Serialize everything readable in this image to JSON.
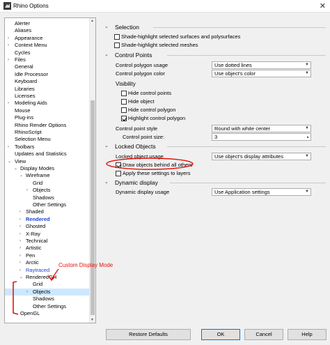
{
  "window": {
    "title": "Rhino Options",
    "close_glyph": "✕"
  },
  "tree": {
    "items": [
      {
        "label": "Alerter",
        "level": 0,
        "arrow": ""
      },
      {
        "label": "Aliases",
        "level": 0,
        "arrow": ""
      },
      {
        "label": "Appearance",
        "level": 0,
        "arrow": "›"
      },
      {
        "label": "Context Menu",
        "level": 0,
        "arrow": "›"
      },
      {
        "label": "Cycles",
        "level": 0,
        "arrow": ""
      },
      {
        "label": "Files",
        "level": 0,
        "arrow": "›"
      },
      {
        "label": "General",
        "level": 0,
        "arrow": ""
      },
      {
        "label": "Idle Processor",
        "level": 0,
        "arrow": ""
      },
      {
        "label": "Keyboard",
        "level": 0,
        "arrow": ""
      },
      {
        "label": "Libraries",
        "level": 0,
        "arrow": ""
      },
      {
        "label": "Licenses",
        "level": 0,
        "arrow": ""
      },
      {
        "label": "Modeling Aids",
        "level": 0,
        "arrow": "›"
      },
      {
        "label": "Mouse",
        "level": 0,
        "arrow": ""
      },
      {
        "label": "Plug-ins",
        "level": 0,
        "arrow": ""
      },
      {
        "label": "Rhino Render Options",
        "level": 0,
        "arrow": ""
      },
      {
        "label": "RhinoScript",
        "level": 0,
        "arrow": ""
      },
      {
        "label": "Selection Menu",
        "level": 0,
        "arrow": ""
      },
      {
        "label": "Toolbars",
        "level": 0,
        "arrow": "›"
      },
      {
        "label": "Updates and Statistics",
        "level": 0,
        "arrow": ""
      },
      {
        "label": "View",
        "level": 0,
        "arrow": "⌄"
      },
      {
        "label": "Display Modes",
        "level": 1,
        "arrow": "⌄"
      },
      {
        "label": "Wireframe",
        "level": 2,
        "arrow": "⌄"
      },
      {
        "label": "Grid",
        "level": 3,
        "arrow": ""
      },
      {
        "label": "Objects",
        "level": 3,
        "arrow": "›"
      },
      {
        "label": "Shadows",
        "level": 3,
        "arrow": ""
      },
      {
        "label": "Other Settings",
        "level": 3,
        "arrow": ""
      },
      {
        "label": "Shaded",
        "level": 2,
        "arrow": "›"
      },
      {
        "label": "Rendered",
        "level": 2,
        "arrow": "›",
        "style": "bold-blue"
      },
      {
        "label": "Ghosted",
        "level": 2,
        "arrow": "›"
      },
      {
        "label": "X-Ray",
        "level": 2,
        "arrow": "›"
      },
      {
        "label": "Technical",
        "level": 2,
        "arrow": "›"
      },
      {
        "label": "Artistic",
        "level": 2,
        "arrow": "›"
      },
      {
        "label": "Pen",
        "level": 2,
        "arrow": "›"
      },
      {
        "label": "Arctic",
        "level": 2,
        "arrow": "›"
      },
      {
        "label": "Raytraced",
        "level": 2,
        "arrow": "›",
        "style": "blue"
      },
      {
        "label": "RenderedGH",
        "level": 2,
        "arrow": "⌄"
      },
      {
        "label": "Grid",
        "level": 3,
        "arrow": ""
      },
      {
        "label": "Objects",
        "level": 3,
        "arrow": "›",
        "selected": true
      },
      {
        "label": "Shadows",
        "level": 3,
        "arrow": ""
      },
      {
        "label": "Other Settings",
        "level": 3,
        "arrow": ""
      },
      {
        "label": "OpenGL",
        "level": 1,
        "arrow": ""
      }
    ]
  },
  "sections": {
    "selection": {
      "title": "Selection",
      "shade_surfaces": "Shade-highlight selected surfaces and polysurfaces",
      "shade_meshes": "Shade-highlight selected meshes"
    },
    "control_points": {
      "title": "Control Points",
      "polygon_usage_label": "Control polygon usage",
      "polygon_usage_value": "Use dotted lines",
      "polygon_color_label": "Control polygon color",
      "polygon_color_value": "Use object's color",
      "visibility_label": "Visibility",
      "hide_control_points": "Hide control points",
      "hide_object": "Hide object",
      "hide_control_polygon": "Hide control polygon",
      "highlight_control_polygon": "Highlight control polygon",
      "point_style_label": "Control point style",
      "point_style_value": "Round with white center",
      "point_size_label": "Control point size:",
      "point_size_value": "3"
    },
    "locked_objects": {
      "title": "Locked Objects",
      "usage_label": "Locked object usage",
      "usage_value": "Use object's display attributes",
      "draw_behind": "Draw objects behind all others",
      "apply_to_layers": "Apply these settings to layers"
    },
    "dynamic_display": {
      "title": "Dynamic display",
      "usage_label": "Dynamic display usage",
      "usage_value": "Use Application settings"
    }
  },
  "buttons": {
    "restore_defaults": "Restore Defaults",
    "ok": "OK",
    "cancel": "Cancel",
    "help": "Help"
  },
  "annotation": {
    "text": "Custom Display Mode",
    "color": "#e8120c"
  },
  "colors": {
    "selection_bg": "#cce8ff",
    "rendered_text": "#1f3fd6",
    "accent_border": "#0078d7"
  }
}
